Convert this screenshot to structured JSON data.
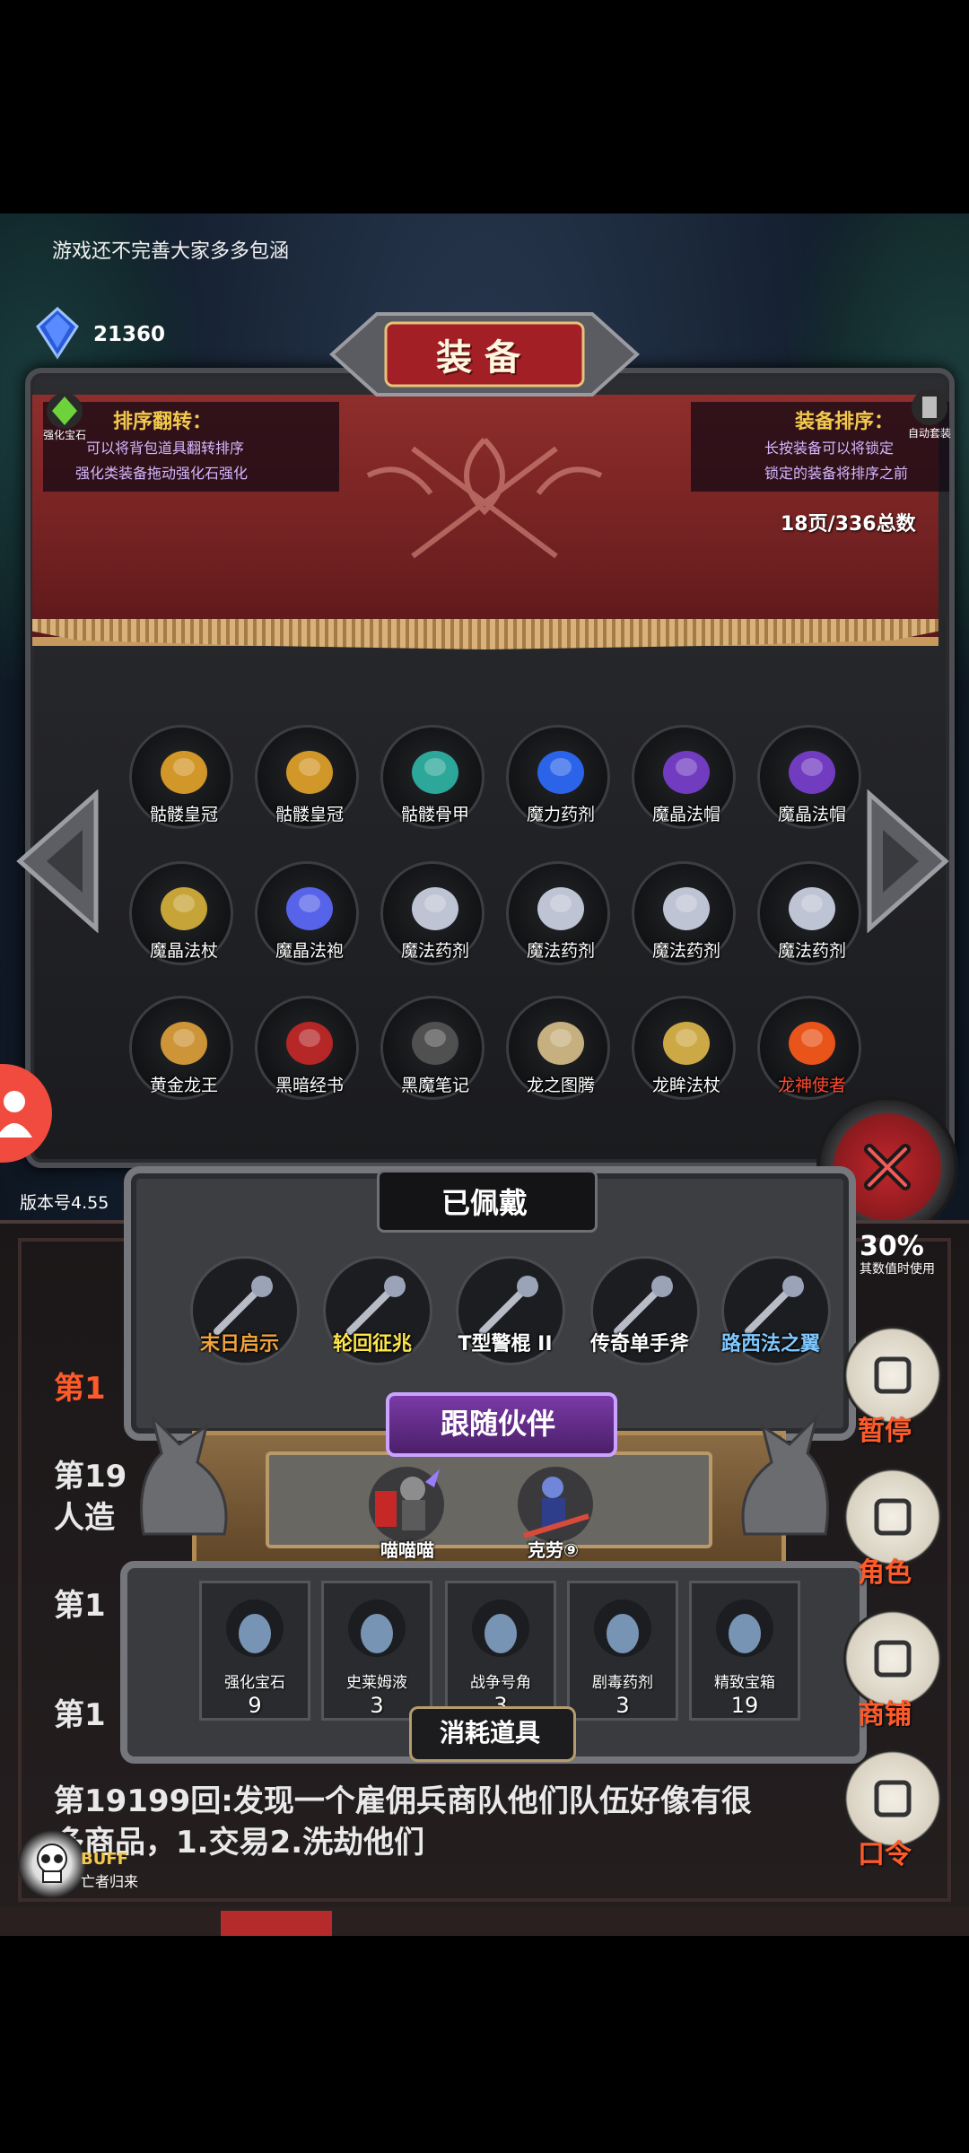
{
  "notice": "游戏还不完善大家多多包涵",
  "gems": {
    "count": "21360",
    "icon_label": "宝石"
  },
  "title": "装备",
  "hints": {
    "left_title": "排序翻转：",
    "left_lines": [
      "可以将背包道具翻转排序",
      "强化类装备拖动强化石强化"
    ],
    "right_title": "装备排序：",
    "right_lines": [
      "长按装备可以将锁定",
      "锁定的装备将排序之前"
    ],
    "left_corner_label": "强化宝石",
    "right_corner_label": "自动套装"
  },
  "page_info": "18页/336总数",
  "inventory": [
    {
      "label": "骷髅皇冠",
      "icon": "skull-crown-icon",
      "red": false
    },
    {
      "label": "骷髅皇冠",
      "icon": "skull-crown-icon",
      "red": false
    },
    {
      "label": "骷髅骨甲",
      "icon": "bone-armor-icon",
      "red": false
    },
    {
      "label": "魔力药剂",
      "icon": "mana-potion-icon",
      "red": false
    },
    {
      "label": "魔晶法帽",
      "icon": "wizard-hat-icon",
      "red": false
    },
    {
      "label": "魔晶法帽",
      "icon": "wizard-hat-icon",
      "red": false
    },
    {
      "label": "魔晶法杖",
      "icon": "staff-icon",
      "red": false
    },
    {
      "label": "魔晶法袍",
      "icon": "robe-icon",
      "red": false
    },
    {
      "label": "魔法药剂",
      "icon": "potion-icon",
      "red": false
    },
    {
      "label": "魔法药剂",
      "icon": "potion-icon",
      "red": false
    },
    {
      "label": "魔法药剂",
      "icon": "potion-icon",
      "red": false
    },
    {
      "label": "魔法药剂",
      "icon": "potion-icon",
      "red": false
    },
    {
      "label": "黄金龙王",
      "icon": "golden-dragon-icon",
      "red": false
    },
    {
      "label": "黑暗经书",
      "icon": "red-book-icon",
      "red": false
    },
    {
      "label": "黑魔笔记",
      "icon": "black-book-icon",
      "red": false
    },
    {
      "label": "龙之图腾",
      "icon": "dragon-totem-icon",
      "red": false
    },
    {
      "label": "龙眸法杖",
      "icon": "dragon-staff-icon",
      "red": false
    },
    {
      "label": "龙神使者",
      "icon": "dragon-god-icon",
      "red": true
    }
  ],
  "version": "版本号4.55",
  "equipped": {
    "title": "已佩戴",
    "items": [
      {
        "label": "末日启示",
        "color": "#f2a23a",
        "icon": "doom-mace-icon"
      },
      {
        "label": "轮回征兆",
        "color": "#ffe64a",
        "icon": "ice-staff-icon"
      },
      {
        "label": "T型警棍 II",
        "color": "#ffffff",
        "icon": "baton-icon"
      },
      {
        "label": "传奇单手斧",
        "color": "#ffffff",
        "icon": "axe-icon"
      },
      {
        "label": "路西法之翼",
        "color": "#7ec8ff",
        "icon": "wings-icon"
      }
    ]
  },
  "companions": {
    "title": "跟随伙伴",
    "items": [
      {
        "label": "喵喵喵",
        "color": "#ffd21a",
        "icon": "cat-warrior-icon"
      },
      {
        "label": "克劳⑨",
        "color": "#ffd21a",
        "icon": "knight-icon"
      }
    ]
  },
  "consumables": {
    "title": "消耗道具",
    "items": [
      {
        "label": "强化宝石",
        "count": "9",
        "icon": "green-gem-icon"
      },
      {
        "label": "史莱姆液",
        "count": "3",
        "icon": "slime-potion-icon"
      },
      {
        "label": "战争号角",
        "count": "3",
        "icon": "war-horn-icon"
      },
      {
        "label": "剧毒药剂",
        "count": "3",
        "icon": "poison-potion-icon"
      },
      {
        "label": "精致宝箱",
        "count": "19",
        "icon": "chest-icon"
      }
    ]
  },
  "side_menu": {
    "percent": "30%",
    "percent_sub": "其数值时使用",
    "items": [
      {
        "label": "暂停",
        "icon": "dice-icon"
      },
      {
        "label": "角色",
        "icon": "hood-icon"
      },
      {
        "label": "商铺",
        "icon": "shop-icon"
      },
      {
        "label": "口令",
        "icon": "scroll-icon"
      }
    ]
  },
  "log": {
    "line1": "第1",
    "line2a": "第19",
    "line2b": "人造",
    "line3": "第1",
    "line4": "第1",
    "line5": "第19199回:发现一个雇佣兵商队他们队伍好像有很",
    "line6": "多商品，1.交易2.洗劫他们"
  },
  "buff": {
    "title": "BUFF",
    "subtitle": "亡者归来"
  }
}
